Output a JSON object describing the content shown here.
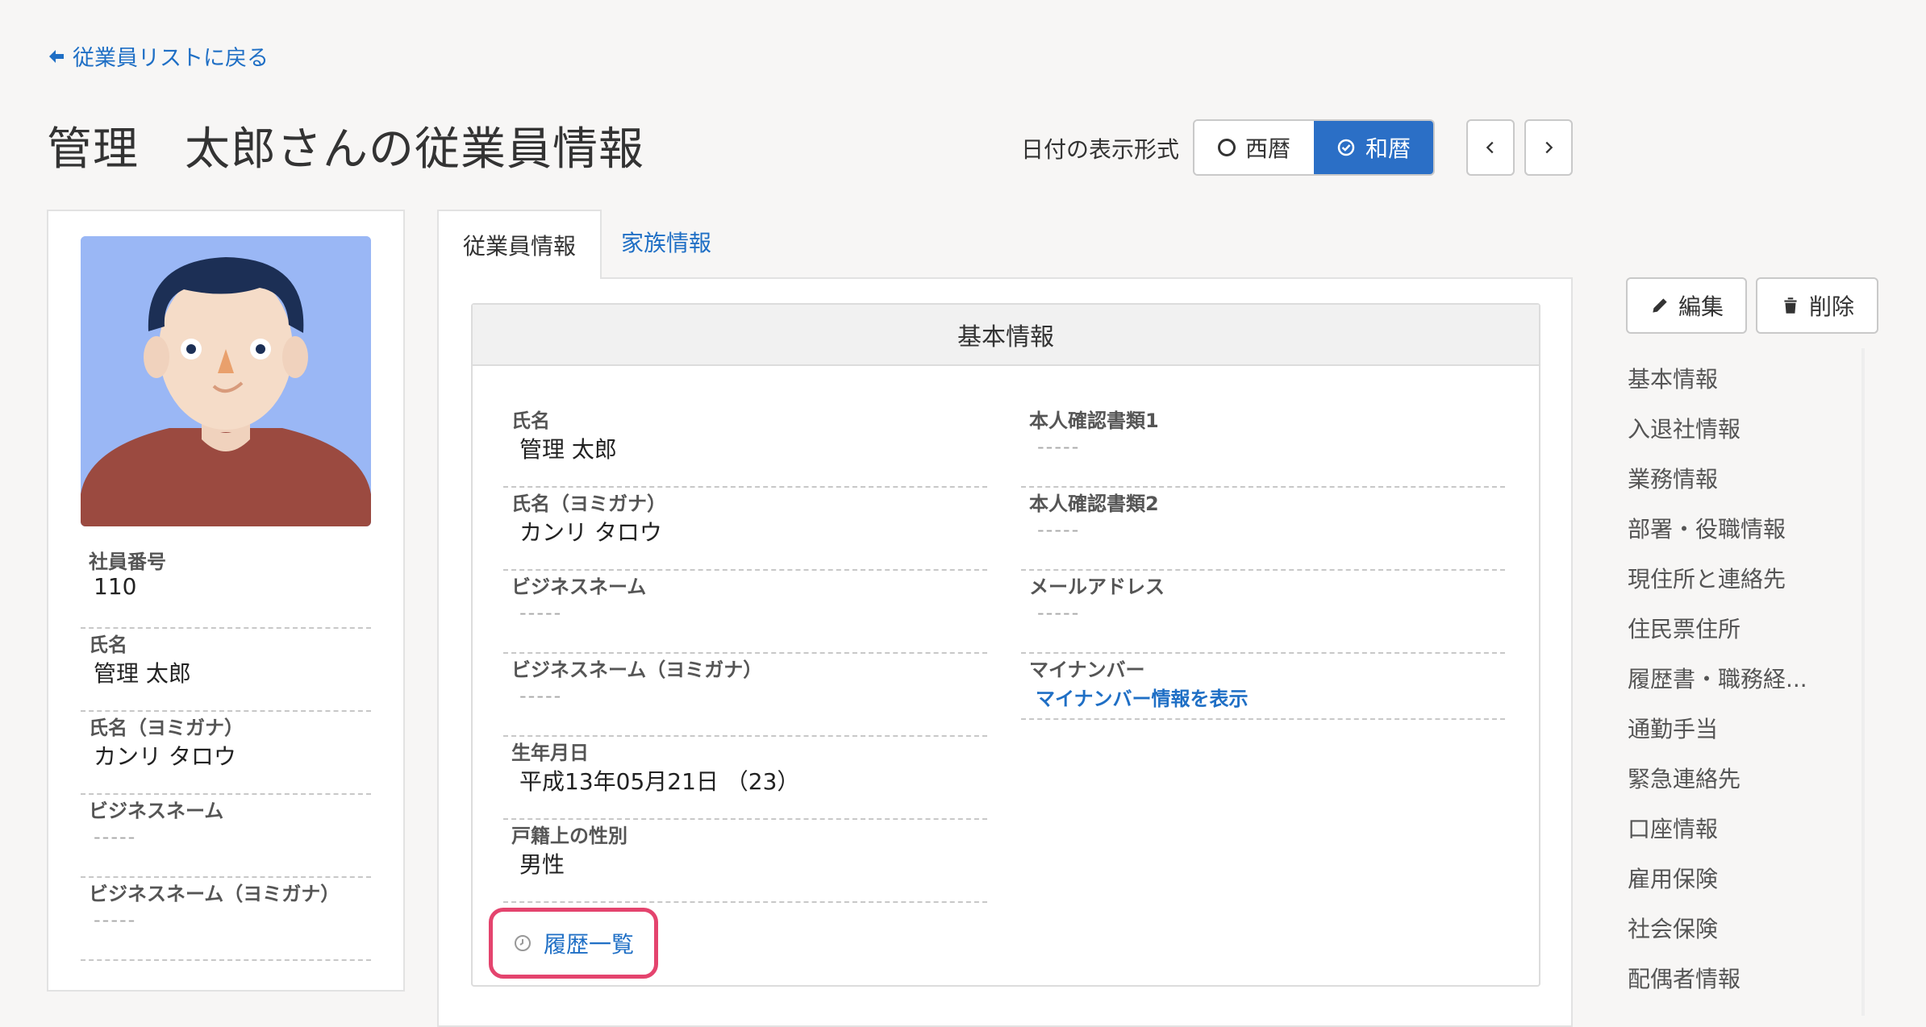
{
  "back_link": "従業員リストに戻る",
  "page_title": "管理　太郎さんの従業員情報",
  "date_format": {
    "label": "日付の表示形式",
    "options": [
      "西暦",
      "和暦"
    ],
    "selected": "和暦"
  },
  "profile": {
    "fields": [
      {
        "label": "社員番号",
        "value": "110"
      },
      {
        "label": "氏名",
        "value": "管理 太郎"
      },
      {
        "label": "氏名（ヨミガナ）",
        "value": "カンリ タロウ"
      },
      {
        "label": "ビジネスネーム",
        "value": "-----"
      },
      {
        "label": "ビジネスネーム（ヨミガナ）",
        "value": "-----"
      }
    ]
  },
  "tabs": [
    "従業員情報",
    "家族情報"
  ],
  "section_title": "基本情報",
  "left_fields": [
    {
      "label": "氏名",
      "value": "管理 太郎"
    },
    {
      "label": "氏名（ヨミガナ）",
      "value": "カンリ タロウ"
    },
    {
      "label": "ビジネスネーム",
      "value": "-----"
    },
    {
      "label": "ビジネスネーム（ヨミガナ）",
      "value": "-----"
    },
    {
      "label": "生年月日",
      "value": "平成13年05月21日 （23）"
    },
    {
      "label": "戸籍上の性別",
      "value": "男性"
    }
  ],
  "right_fields": [
    {
      "label": "本人確認書類1",
      "value": "-----"
    },
    {
      "label": "本人確認書類2",
      "value": "-----"
    },
    {
      "label": "メールアドレス",
      "value": "-----"
    },
    {
      "label": "マイナンバー",
      "link": "マイナンバー情報を表示"
    }
  ],
  "history_link": "履歴一覧",
  "actions": {
    "edit": "編集",
    "delete": "削除"
  },
  "side_nav": [
    "基本情報",
    "入退社情報",
    "業務情報",
    "部署・役職情報",
    "現住所と連絡先",
    "住民票住所",
    "履歴書・職務経...",
    "通勤手当",
    "緊急連絡先",
    "口座情報",
    "雇用保険",
    "社会保険",
    "配偶者情報"
  ],
  "colors": {
    "accent": "#2b6fc6",
    "link": "#1f6fc5",
    "highlight": "#e4446e"
  }
}
